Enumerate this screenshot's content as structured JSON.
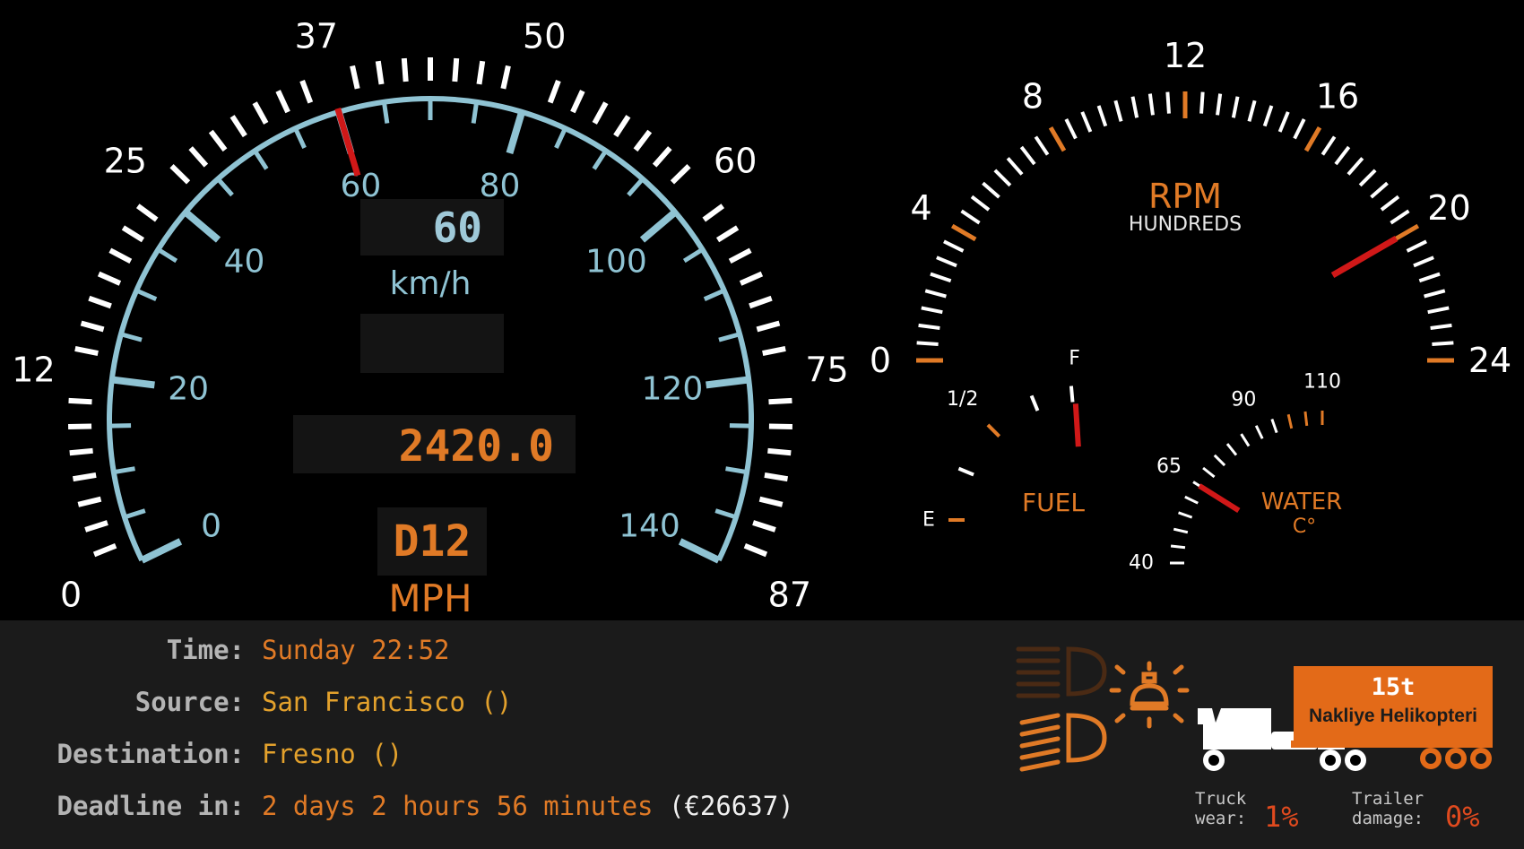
{
  "speedometer": {
    "outer_labels": [
      "0",
      "12",
      "25",
      "37",
      "50",
      "60",
      "75",
      "87"
    ],
    "inner_labels": [
      "0",
      "20",
      "40",
      "60",
      "80",
      "100",
      "120",
      "140"
    ],
    "needle_kmh": 60,
    "digital_speed": "60",
    "unit_label": "km/h",
    "odometer": "2420.0",
    "gear": "D12",
    "outer_unit": "MPH"
  },
  "tachometer": {
    "labels": [
      "0",
      "4",
      "8",
      "12",
      "16",
      "20",
      "24"
    ],
    "title": "RPM",
    "subtitle": "HUNDREDS",
    "needle_hundreds": 20
  },
  "fuel": {
    "labels": {
      "empty": "E",
      "half": "1/2",
      "full": "F"
    },
    "title": "FUEL",
    "level_fraction": 0.96
  },
  "water": {
    "labels": [
      "40",
      "65",
      "90",
      "110"
    ],
    "title": "WATER",
    "unit": "C°",
    "temperature": 65
  },
  "trip": {
    "time_label": "Time:",
    "time_value": "Sunday 22:52",
    "source_label": "Source:",
    "source_value": "San Francisco ()",
    "destination_label": "Destination:",
    "destination_value": "Fresno ()",
    "deadline_label": "Deadline in:",
    "deadline_value": "2 days 2 hours 56 minutes",
    "income": "(€26637)"
  },
  "cargo": {
    "weight": "15t",
    "name": "Nakliye Helikopteri"
  },
  "damage": {
    "truck_label_1": "Truck",
    "truck_label_2": "wear:",
    "truck_value": "1%",
    "trailer_label_1": "Trailer",
    "trailer_label_2": "damage:",
    "trailer_value": "0%"
  },
  "indicators": {
    "low_beam": "low-beam-icon",
    "high_beam": "high-beam-icon",
    "beacon": "beacon-icon",
    "low_beam_active": false,
    "high_beam_active": true,
    "beacon_active": true
  },
  "colors": {
    "orange": "#e07a26",
    "blue": "#8fc3d3",
    "needle": "#d01818",
    "amber": "#e3a12c"
  }
}
